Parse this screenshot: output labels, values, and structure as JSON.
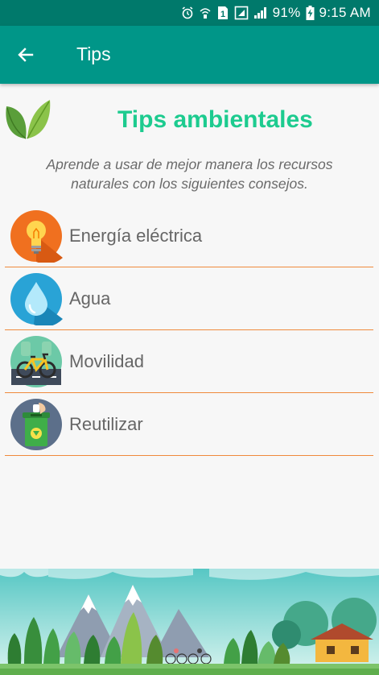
{
  "status_bar": {
    "battery": "91%",
    "time": "9:15 AM",
    "sim_number": "1"
  },
  "app_bar": {
    "title": "Tips",
    "back_icon": "arrow-back-icon"
  },
  "header": {
    "title": "Tips ambientales",
    "logo_icon": "leaf-icon"
  },
  "subtitle": "Aprende a usar de mejor manera los recursos naturales con los siguientes consejos.",
  "tips": [
    {
      "label": "Energía eléctrica",
      "icon": "lightbulb-icon"
    },
    {
      "label": "Agua",
      "icon": "water-drop-icon"
    },
    {
      "label": "Movilidad",
      "icon": "bicycle-icon"
    },
    {
      "label": "Reutilizar",
      "icon": "recycle-bin-icon"
    }
  ],
  "colors": {
    "status_bar": "#00796b",
    "app_bar": "#009688",
    "accent_green": "#1dcb8f",
    "divider_orange": "#ef8a3c"
  }
}
